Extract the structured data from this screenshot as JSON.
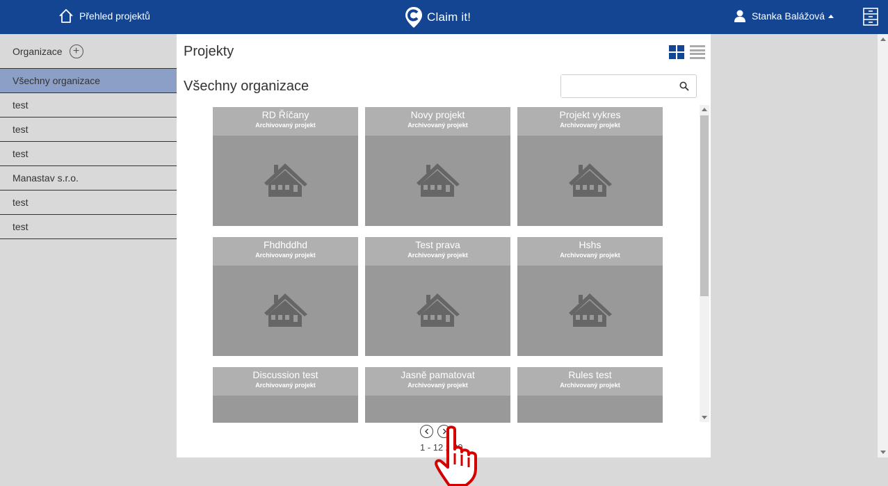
{
  "header": {
    "home_label": "Přehled projektů",
    "brand": "Claim it!",
    "user_name": "Stanka Balážová"
  },
  "sidebar": {
    "header_label": "Organizace",
    "items": [
      {
        "label": "Všechny organizace",
        "active": true
      },
      {
        "label": "test"
      },
      {
        "label": "test"
      },
      {
        "label": "test"
      },
      {
        "label": "Manastav s.r.o."
      },
      {
        "label": "test"
      },
      {
        "label": "test"
      }
    ]
  },
  "main": {
    "title": "Projekty",
    "subtitle": "Všechny organizace",
    "search": {
      "value": "",
      "placeholder": ""
    },
    "projects": [
      {
        "name": "RD Říčany",
        "status": "Archivovaný projekt"
      },
      {
        "name": "Novy projekt",
        "status": "Archivovaný projekt"
      },
      {
        "name": "Projekt vykres",
        "status": "Archivovaný projekt"
      },
      {
        "name": "Fhdhddhd",
        "status": "Archivovaný projekt"
      },
      {
        "name": "Test prava",
        "status": "Archivovaný projekt"
      },
      {
        "name": "Hshs",
        "status": "Archivovaný projekt"
      },
      {
        "name": "Discussion test",
        "status": "Archivovaný projekt"
      },
      {
        "name": "Jasně pamatovat",
        "status": "Archivovaný projekt"
      },
      {
        "name": "Rules test",
        "status": "Archivovaný projekt"
      }
    ],
    "pagination": {
      "text": "1 - 12 z 20"
    }
  },
  "colors": {
    "header_bg": "#134593",
    "sidebar_active": "#8c9fc6",
    "card_body": "#999999",
    "card_head": "#b0b0b0"
  }
}
